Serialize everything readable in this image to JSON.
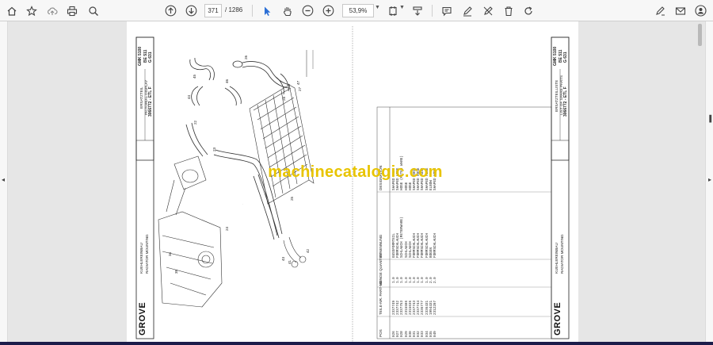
{
  "toolbar": {
    "page_current": "371",
    "page_total": "/ 1286",
    "zoom": "53,9%",
    "colors": {
      "cursor_active": "#2b6fd6"
    }
  },
  "watermark": "machinecatalogic.com",
  "left_sheet": {
    "brand": "GROVE",
    "title_de": "KUEHLEREINBAU",
    "title_en": "RADIATOR MOUNTING",
    "doc_no": "3066772 - ETL F",
    "model": "GMK 5100",
    "model_code": "BE 511",
    "page_code": "G 631",
    "subtitle_de": "ERSATZTEIL",
    "subtitle_en": "PICTORIAL DISPLAY",
    "callouts": [
      "44",
      "45",
      "46",
      "47",
      "26",
      "22",
      "23",
      "24",
      "25",
      "43",
      "41",
      "42",
      "34",
      "35",
      "27",
      "28"
    ]
  },
  "right_sheet": {
    "brand": "GROVE",
    "title_de": "KUEHLEREINBAU",
    "title_en": "RADIATOR MOUNTING",
    "doc_no": "3066772 - ETL F",
    "model": "GMK 5100",
    "model_code": "BE 511",
    "page_code": "G 631",
    "subtitle_de": "ERSATZTEILLISTE",
    "subtitle_en": "LIST OF SPARE PARTS",
    "header": {
      "pos": "POS",
      "part_no": "TEILE-NR. PART-NO",
      "qty": "MENGE QUANTITY",
      "bez": "BENENNUNG",
      "designation": "DESIGNATION"
    },
    "rows": [
      {
        "pos": "026",
        "part": "2337749",
        "qty": "1.0",
        "de": "GUSSFORMTEIL",
        "en": "SHAPED PART"
      },
      {
        "pos": "027",
        "part": "2337742",
        "qty": "1.0",
        "de": "FORMSCHLAUCH",
        "en": "SHAPED HOSE"
      },
      {
        "pos": "028",
        "part": "2337753",
        "qty": "1.0",
        "de": "SCHLAUCH (METERWARE)",
        "en": "HOSE (METER WARE)"
      },
      {
        "pos": "029",
        "part": "2315506",
        "qty": "1.0",
        "de": "SCHLAUCH",
        "en": "HOSE"
      },
      {
        "pos": "030",
        "part": "2315636",
        "qty": "1.0",
        "de": "SCHLAUCH",
        "en": "HOSE"
      },
      {
        "pos": "031",
        "part": "2337743",
        "qty": "1.0",
        "de": "FORMSCHLAUCH",
        "en": "SHAPED HOSE"
      },
      {
        "pos": "032",
        "part": "2337744",
        "qty": "1.0",
        "de": "FORMSCHLAUCH",
        "en": "SHAPED HOSE"
      },
      {
        "pos": "033",
        "part": "2336777",
        "qty": "1.0",
        "de": "FORMSCHLAUCH",
        "en": "SHAPED HOSE"
      },
      {
        "pos": "034",
        "part": "2336431",
        "qty": "1.0",
        "de": "FORMSCHLAUCH",
        "en": "SHAPED HOSE"
      },
      {
        "pos": "035",
        "part": "1994431",
        "qty": "2.0",
        "de": "BOGEN",
        "en": "ELBOW"
      },
      {
        "pos": "049",
        "part": "2312207",
        "qty": "2.0",
        "de": "FORMSCHLAUCH",
        "en": "SHAPED HOSE"
      }
    ]
  }
}
